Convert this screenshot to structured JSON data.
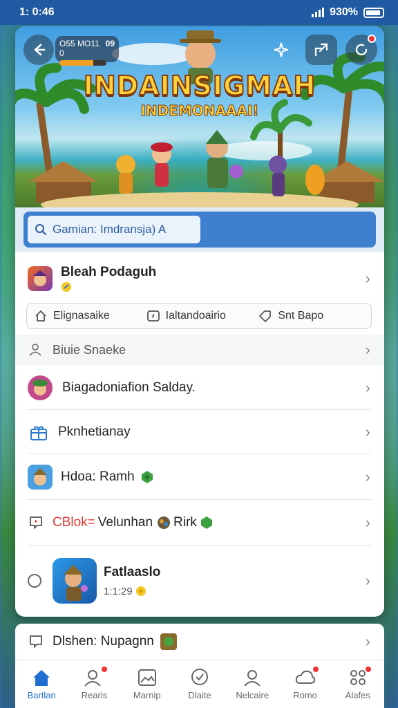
{
  "status_bar": {
    "time": "1: 0:46",
    "battery_text": "930%"
  },
  "hero": {
    "title": "INDAINSIGMAH",
    "subtitle": "INDEMONAAAI!",
    "progress_text": "O55 MO11 0",
    "progress_value": "09",
    "progress_fraction": 0.72
  },
  "search": {
    "placeholder": "Gamian: Imdransja) A"
  },
  "profile": {
    "name": "Bleah Podaguh"
  },
  "chips": [
    {
      "label": "Elignasaike"
    },
    {
      "label": "Ialtandoairio"
    },
    {
      "label": "Snt Bapo"
    }
  ],
  "list": {
    "sub_row": "Biuie Snaeke",
    "items": [
      {
        "label": "Biagadoniafion Salday."
      },
      {
        "label": "Pknhetianay"
      },
      {
        "label": "Hdoa: Ramh"
      },
      {
        "label_red": "CBlok=",
        "label": "Velunhan",
        "label_tail": "Rirk"
      },
      {
        "label": "Fatlaaslo",
        "meta": "1:1:29"
      }
    ],
    "bottom_row": "Dlshen: Nupagnn"
  },
  "tabs": [
    {
      "label": "Bartlan"
    },
    {
      "label": "Rearis"
    },
    {
      "label": "Marnip"
    },
    {
      "label": "Dlaite"
    },
    {
      "label": "Nelcaire"
    },
    {
      "label": "Romo"
    },
    {
      "label": "Alafes"
    }
  ],
  "colors": {
    "accent": "#1f6fd1",
    "search_bar": "#3e7fd0",
    "title_gold": "#ffd23a",
    "alert_red": "#e53935"
  }
}
